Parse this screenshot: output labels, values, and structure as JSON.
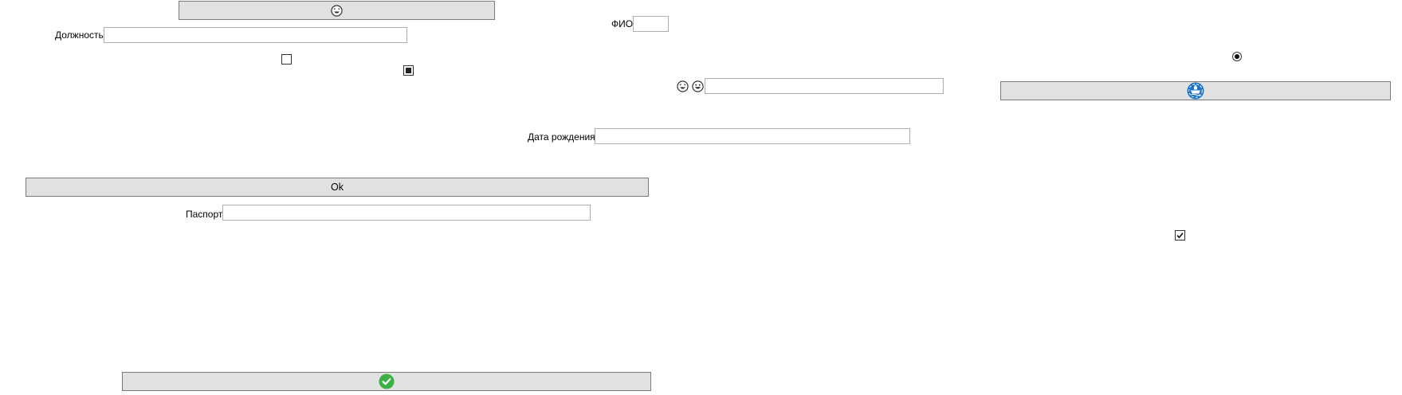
{
  "fields": {
    "position_label": "Должность",
    "position_value": "",
    "fio_label": "ФИО",
    "fio_value": "",
    "birth_label": "Дата рождения",
    "birth_value": "",
    "passport_label": "Паспорт",
    "passport_value": "",
    "emoji_field_value": ""
  },
  "buttons": {
    "ok_label": "Ok"
  },
  "icons": {
    "top_button": "laughing-face-icon",
    "emoji_1": "laughing-face-icon",
    "emoji_2": "grinning-face-icon",
    "right_button": "ship-icon",
    "bottom_button": "green-check-icon"
  },
  "controls": {
    "checkbox_1": "unchecked",
    "checkbox_2": "indeterminate",
    "checkbox_3": "checked",
    "radio_1": "selected"
  },
  "colors": {
    "button_bg": "#e1e1e1",
    "button_border": "#7a7a7a",
    "field_border": "#adadad",
    "ship_blue": "#1a73c8",
    "check_green": "#3cb043"
  }
}
